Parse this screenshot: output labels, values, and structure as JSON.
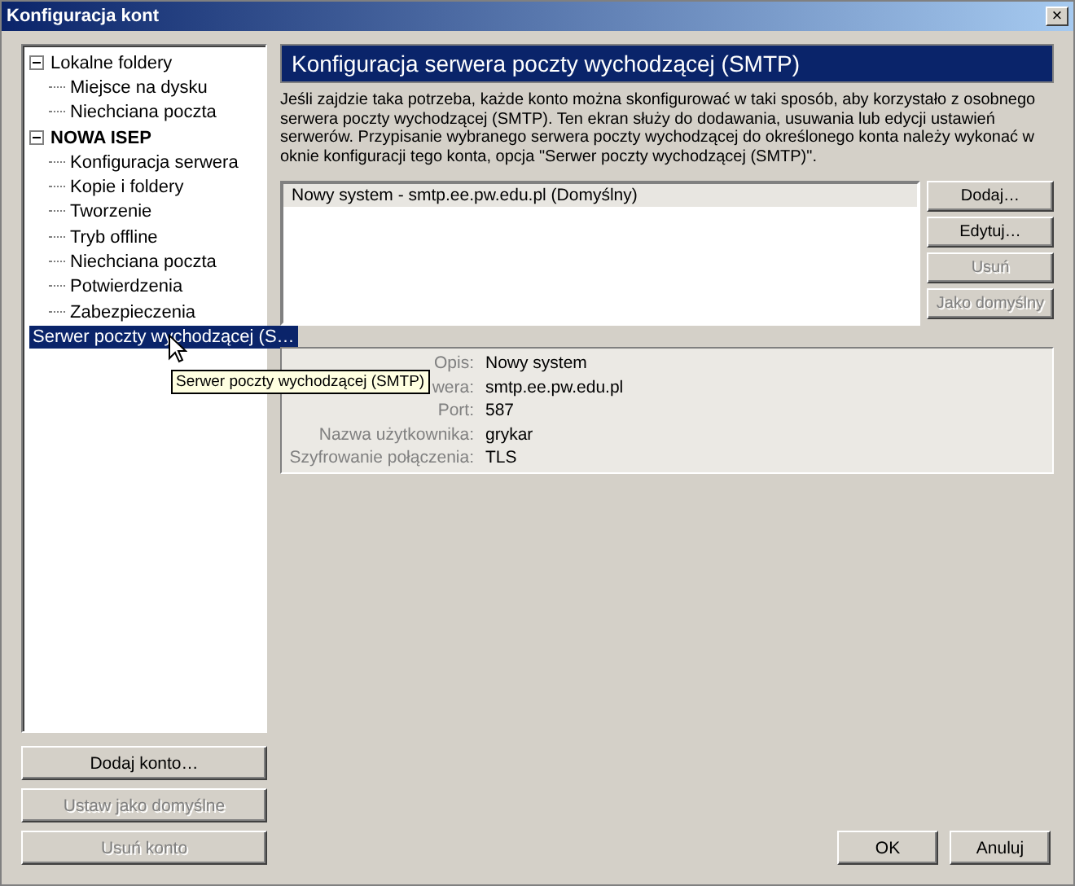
{
  "window": {
    "title": "Konfiguracja kont",
    "close": "×"
  },
  "tree": [
    {
      "label": "Lokalne foldery",
      "bold": false,
      "expanded": true,
      "selected": false,
      "children": [
        {
          "label": "Miejsce na dysku",
          "selected": false
        },
        {
          "label": "Niechciana poczta",
          "selected": false
        }
      ]
    },
    {
      "label": "NOWA ISEP",
      "bold": true,
      "expanded": true,
      "selected": false,
      "children": [
        {
          "label": "Konfiguracja serwera",
          "selected": false
        },
        {
          "label": "Kopie i foldery",
          "selected": false
        },
        {
          "label": "Tworzenie",
          "selected": false
        },
        {
          "label": "Tryb offline",
          "selected": false
        },
        {
          "label": "Niechciana poczta",
          "selected": false
        },
        {
          "label": "Potwierdzenia",
          "selected": false
        },
        {
          "label": "Zabezpieczenia",
          "selected": false
        }
      ]
    },
    {
      "label": "Serwer poczty wychodzącej (S…",
      "bold": false,
      "selected": true
    }
  ],
  "tooltip": "Serwer poczty wychodzącej (SMTP)",
  "account_buttons": [
    {
      "label": "Dodaj konto…",
      "disabled": false
    },
    {
      "label": "Ustaw jako domyślne",
      "disabled": true
    },
    {
      "label": "Usuń konto",
      "disabled": true
    }
  ],
  "header": "Konfiguracja serwera poczty wychodzącej (SMTP)",
  "description": "Jeśli zajdzie taka potrzeba, każde konto można skonfigurować w taki sposób, aby korzystało z osobnego serwera poczty wychodzącej (SMTP). Ten ekran służy do dodawania, usuwania lub edycji ustawień serwerów. Przypisanie wybranego serwera poczty wychodzącej do określonego konta należy wykonać w oknie konfiguracji tego konta, opcja \"Serwer poczty wychodzącej (SMTP)\".",
  "servers": [
    {
      "label": "Nowy system - smtp.ee.pw.edu.pl (Domyślny)",
      "selected": true
    }
  ],
  "server_buttons": [
    {
      "label": "Dodaj…",
      "disabled": false
    },
    {
      "label": "Edytuj…",
      "disabled": false
    },
    {
      "label": "Usuń",
      "disabled": true
    },
    {
      "label": "Jako domyślny",
      "disabled": true
    }
  ],
  "details": [
    {
      "label": "Opis:",
      "value": "Nowy system"
    },
    {
      "label": "wera:",
      "value": "smtp.ee.pw.edu.pl"
    },
    {
      "label": "Port:",
      "value": "587"
    },
    {
      "label": "Nazwa użytkownika:",
      "value": "grykar"
    },
    {
      "label": "Szyfrowanie połączenia:",
      "value": "TLS"
    }
  ],
  "dialog_buttons": [
    {
      "label": "OK",
      "disabled": false
    },
    {
      "label": "Anuluj",
      "disabled": false
    }
  ]
}
